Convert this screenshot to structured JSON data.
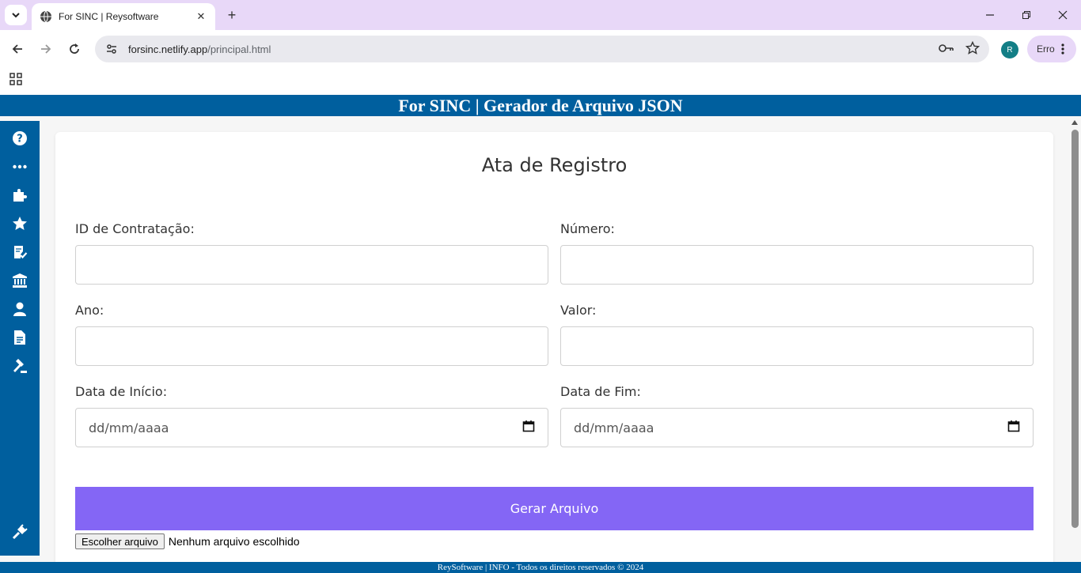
{
  "browser": {
    "tab_title": "For SINC | Reysoftware",
    "url_host": "forsinc.netlify.app",
    "url_path": "/principal.html",
    "profile_initial": "R",
    "error_chip_label": "Erro",
    "new_tab_glyph": "+",
    "close_glyph": "✕"
  },
  "app": {
    "header_title": "For SINC | Gerador de Arquivo JSON",
    "footer_text": "ReySoftware | INFO - Todos os direitos reservados © 2024",
    "brand_color": "#005f9e",
    "accent_color": "#8466f5"
  },
  "sidebar": {
    "items": [
      {
        "icon": "question-circle-icon"
      },
      {
        "icon": "ellipsis-icon"
      },
      {
        "icon": "puzzle-icon"
      },
      {
        "icon": "star-icon"
      },
      {
        "icon": "checklist-icon"
      },
      {
        "icon": "bank-icon"
      },
      {
        "icon": "user-icon"
      },
      {
        "icon": "document-icon"
      },
      {
        "icon": "gavel-icon"
      }
    ],
    "bottom_icon": "plug-icon"
  },
  "form": {
    "title": "Ata de Registro",
    "fields": {
      "id_contratacao": {
        "label": "ID de Contratação:",
        "value": ""
      },
      "numero": {
        "label": "Número:",
        "value": ""
      },
      "ano": {
        "label": "Ano:",
        "value": ""
      },
      "valor": {
        "label": "Valor:",
        "value": ""
      },
      "data_inicio": {
        "label": "Data de Início:",
        "placeholder": "dd/mm/aaaa"
      },
      "data_fim": {
        "label": "Data de Fim:",
        "placeholder": "dd/mm/aaaa"
      }
    },
    "submit_label": "Gerar Arquivo",
    "file_button_label": "Escolher arquivo",
    "file_status": "Nenhum arquivo escolhido"
  }
}
